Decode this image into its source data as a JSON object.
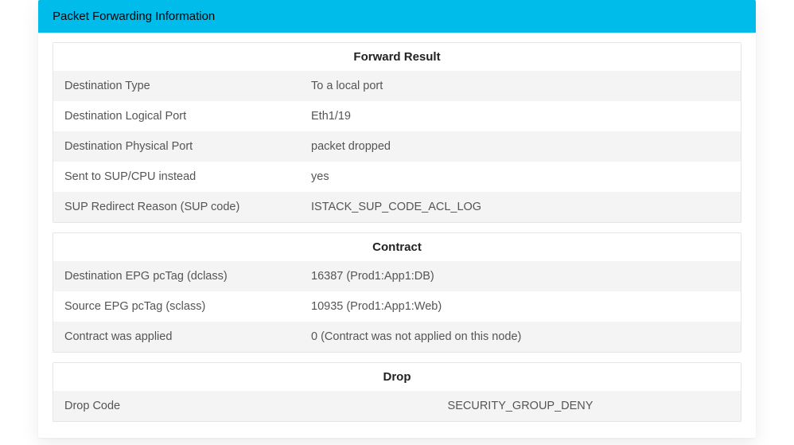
{
  "header": {
    "title": "Packet Forwarding Information"
  },
  "sections": {
    "forward": {
      "title": "Forward Result",
      "rows": [
        {
          "key": "Destination Type",
          "val": "To a local port"
        },
        {
          "key": "Destination Logical Port",
          "val": "Eth1/19"
        },
        {
          "key": "Destination Physical Port",
          "val": "packet dropped"
        },
        {
          "key": "Sent to SUP/CPU instead",
          "val": "yes"
        },
        {
          "key": "SUP Redirect Reason (SUP code)",
          "val": "ISTACK_SUP_CODE_ACL_LOG"
        }
      ]
    },
    "contract": {
      "title": "Contract",
      "rows": [
        {
          "key": "Destination EPG pcTag (dclass)",
          "val": "16387 (Prod1:App1:DB)"
        },
        {
          "key": "Source EPG pcTag (sclass)",
          "val": "10935 (Prod1:App1:Web)"
        },
        {
          "key": "Contract was applied",
          "val": "0 (Contract was not applied on this node)"
        }
      ]
    },
    "drop": {
      "title": "Drop",
      "rows": [
        {
          "key": "Drop Code",
          "val": "SECURITY_GROUP_DENY"
        }
      ]
    }
  }
}
